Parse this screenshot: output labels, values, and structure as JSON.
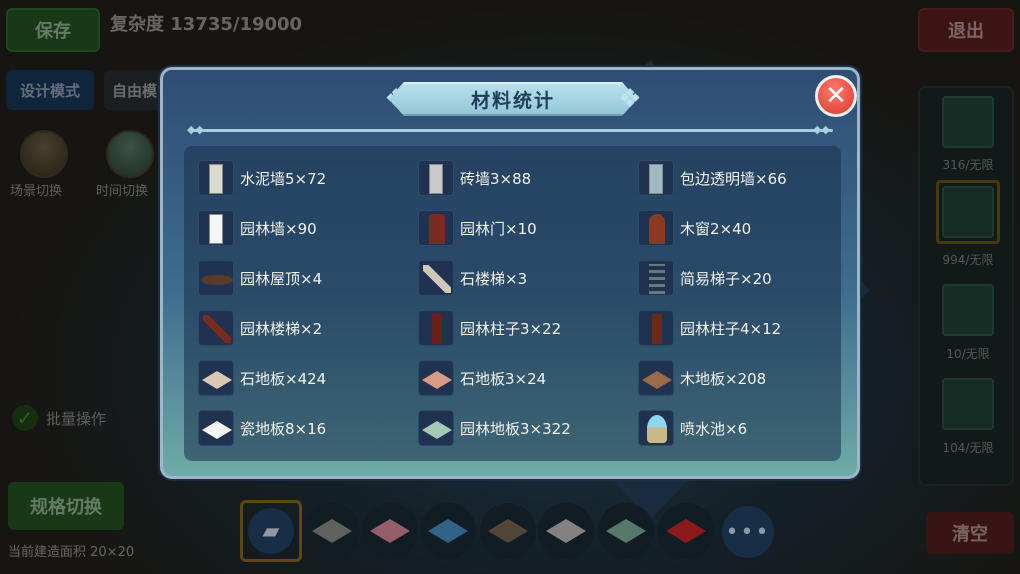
{
  "hud": {
    "save_label": "保存",
    "complexity_label": "复杂度 13735/19000",
    "exit_label": "退出",
    "design_mode_label": "设计模式",
    "free_mode_label": "自由模",
    "scene_switch_label": "场景切换",
    "time_switch_label": "时间切换",
    "batch_label": "批量操作",
    "spec_switch_label": "规格切换",
    "area_label": "当前建造面积 20×20",
    "clear_label": "清空",
    "right_counts": [
      "316/无限",
      "994/无限",
      "10/无限",
      "104/无限"
    ],
    "more_label": "•••"
  },
  "modal": {
    "title": "材料统计",
    "close_icon": "close-x-icon",
    "items": [
      {
        "name": "水泥墙5×72",
        "icon": "cement-wall-icon",
        "color": "#d9d9d0"
      },
      {
        "name": "砖墙3×88",
        "icon": "brick-wall-icon",
        "color": "#c9c9c9"
      },
      {
        "name": "包边透明墙×66",
        "icon": "glass-wall-icon",
        "color": "#9fb9c2"
      },
      {
        "name": "园林墙×90",
        "icon": "garden-wall-icon",
        "color": "#f5f5f5"
      },
      {
        "name": "园林门×10",
        "icon": "garden-door-icon",
        "color": "#7a2a20"
      },
      {
        "name": "木窗2×40",
        "icon": "wood-window-icon",
        "color": "#8a3a22"
      },
      {
        "name": "园林屋顶×4",
        "icon": "garden-roof-icon",
        "color": "#5a3a2a"
      },
      {
        "name": "石楼梯×3",
        "icon": "stone-stairs-icon",
        "color": "#cfc7b8"
      },
      {
        "name": "简易梯子×20",
        "icon": "ladder-icon",
        "color": "#6a7a7a"
      },
      {
        "name": "园林楼梯×2",
        "icon": "garden-stairs-icon",
        "color": "#7a2a1e"
      },
      {
        "name": "园林柱子3×22",
        "icon": "garden-pillar-icon",
        "color": "#6a2018"
      },
      {
        "name": "园林柱子4×12",
        "icon": "garden-pillar-icon",
        "color": "#6a2a1e"
      },
      {
        "name": "石地板×424",
        "icon": "stone-floor-icon",
        "color": "#d8c8b2"
      },
      {
        "name": "石地板3×24",
        "icon": "stone-floor-icon",
        "color": "#d99a86"
      },
      {
        "name": "木地板×208",
        "icon": "wood-floor-icon",
        "color": "#9a6a4a"
      },
      {
        "name": "瓷地板8×16",
        "icon": "tile-floor-icon",
        "color": "#f7f4f2"
      },
      {
        "name": "园林地板3×322",
        "icon": "garden-floor-icon",
        "color": "#a3c8b6"
      },
      {
        "name": "喷水池×6",
        "icon": "fountain-icon",
        "color": "#c9b88a"
      }
    ]
  },
  "bottom_bar": {
    "eraser_icon": "eraser-icon",
    "floors": [
      {
        "icon": "gray-floor-icon",
        "color": "#7c7c76"
      },
      {
        "icon": "pattern-floor-icon",
        "color": "#c07a86"
      },
      {
        "icon": "blue-floor-icon",
        "color": "#3f7fb0"
      },
      {
        "icon": "brown-floor-icon",
        "color": "#6a5a48"
      },
      {
        "icon": "marble-floor-icon",
        "color": "#a9a6a4"
      },
      {
        "icon": "green-floor-icon",
        "color": "#6f9a8a"
      },
      {
        "icon": "red-floor-icon",
        "color": "#b52222"
      }
    ]
  }
}
